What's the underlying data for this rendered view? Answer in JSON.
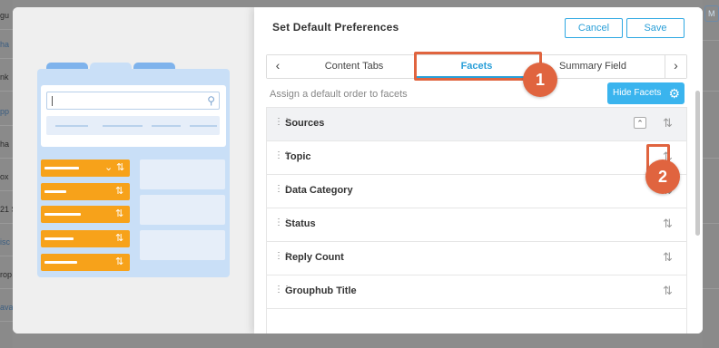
{
  "background": {
    "left_fragments": [
      "gu",
      "ha",
      "nk",
      "pp",
      "ha",
      "ox",
      "21 S",
      "isc",
      "rop",
      "ava"
    ],
    "right_fragment": "M"
  },
  "modal": {
    "title": "Set Default Preferences",
    "cancel_label": "Cancel",
    "save_label": "Save",
    "tabs": [
      {
        "label": "Content Tabs",
        "active": false
      },
      {
        "label": "Facets",
        "active": true
      },
      {
        "label": "Summary Field",
        "active": false
      }
    ],
    "tab_prev_icon": "chevron-left-icon",
    "tab_next_icon": "chevron-right-icon",
    "assign_text": "Assign a default order to facets",
    "hide_facets_label": "Hide Facets",
    "hide_facets_icon": "gear-icon",
    "facets": [
      {
        "label": "Sources",
        "collapsible": true
      },
      {
        "label": "Topic",
        "collapsible": false
      },
      {
        "label": "Data Category",
        "collapsible": false
      },
      {
        "label": "Status",
        "collapsible": false
      },
      {
        "label": "Reply Count",
        "collapsible": false
      },
      {
        "label": "Grouphub Title",
        "collapsible": false
      }
    ],
    "callouts": [
      {
        "number": "1",
        "target": "Facets tab"
      },
      {
        "number": "2",
        "target": "Topic sort icon"
      }
    ]
  },
  "colors": {
    "accent": "#2a9fd8",
    "callout": "#e0643f",
    "illustration_orange": "#f7a21a",
    "illustration_blue": "#c9dff7"
  }
}
